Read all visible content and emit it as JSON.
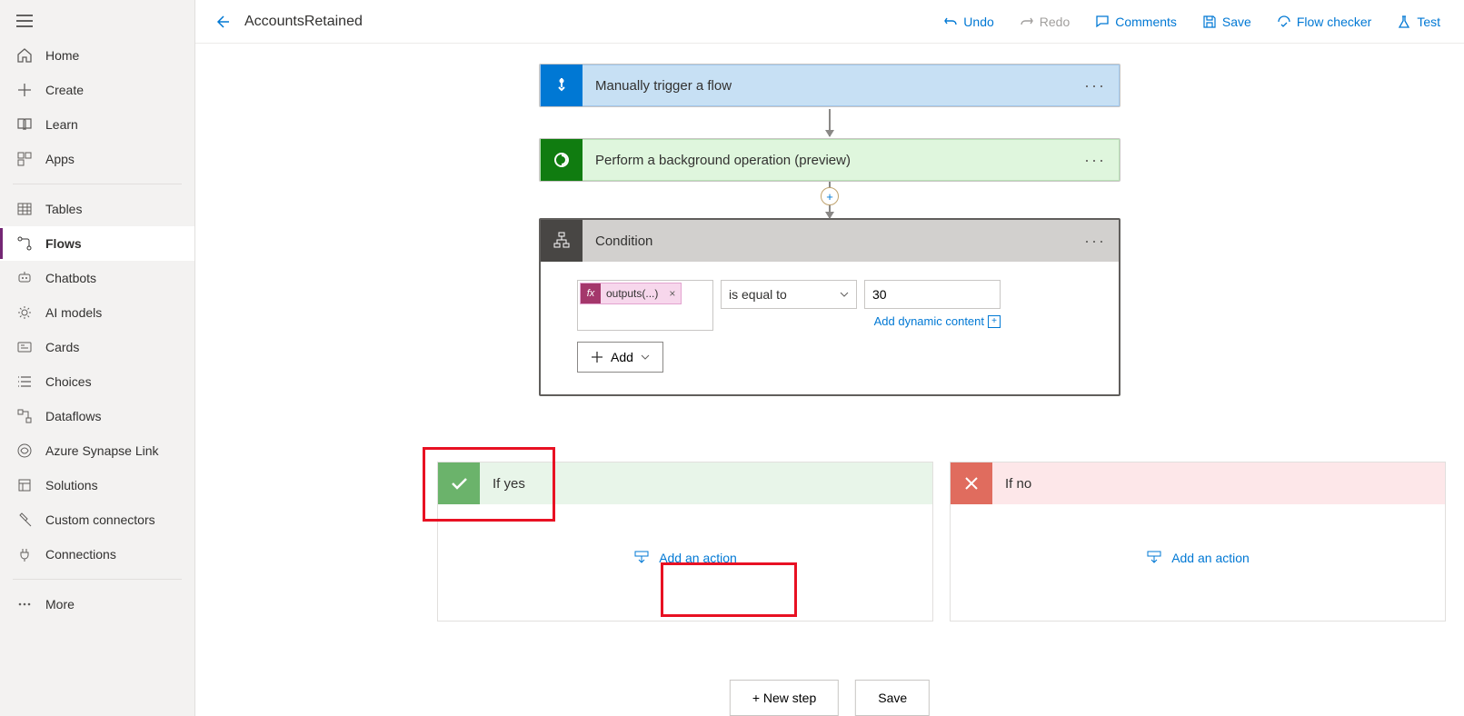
{
  "sidebar": {
    "items": [
      {
        "label": "Home"
      },
      {
        "label": "Create"
      },
      {
        "label": "Learn"
      },
      {
        "label": "Apps"
      },
      {
        "label": "Tables"
      },
      {
        "label": "Flows"
      },
      {
        "label": "Chatbots"
      },
      {
        "label": "AI models"
      },
      {
        "label": "Cards"
      },
      {
        "label": "Choices"
      },
      {
        "label": "Dataflows"
      },
      {
        "label": "Azure Synapse Link"
      },
      {
        "label": "Solutions"
      },
      {
        "label": "Custom connectors"
      },
      {
        "label": "Connections"
      },
      {
        "label": "More"
      }
    ]
  },
  "topbar": {
    "title": "AccountsRetained",
    "undo": "Undo",
    "redo": "Redo",
    "comments": "Comments",
    "save": "Save",
    "flow_checker": "Flow checker",
    "test": "Test"
  },
  "flow": {
    "trigger_label": "Manually trigger a flow",
    "bgop_label": "Perform a background operation (preview)",
    "condition_label": "Condition",
    "condition": {
      "left_token": "outputs(...)",
      "operator": "is equal to",
      "right_value": "30",
      "dynamic_link": "Add dynamic content",
      "add_button": "Add"
    },
    "branch_yes": "If yes",
    "branch_no": "If no",
    "add_action": "Add an action",
    "new_step": "+ New step",
    "save_btn": "Save"
  }
}
